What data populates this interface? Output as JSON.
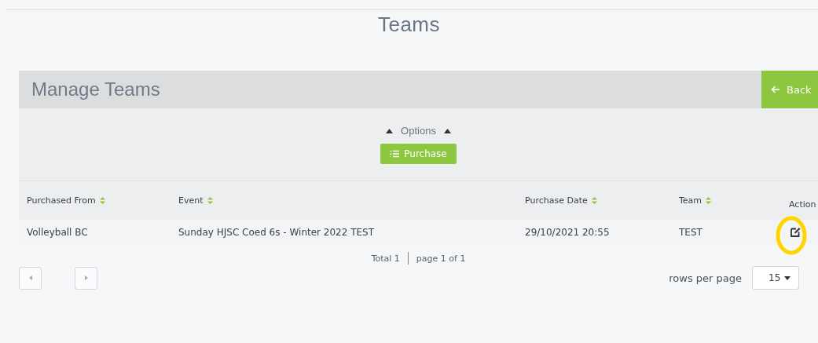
{
  "page": {
    "title": "Teams"
  },
  "panel": {
    "title": "Manage Teams",
    "back_button": "Back"
  },
  "options": {
    "label": "Options",
    "expanded": true,
    "purchase_button": "Purchase"
  },
  "table": {
    "columns": [
      {
        "label": "Purchased From",
        "sortable": true
      },
      {
        "label": "Event",
        "sortable": true
      },
      {
        "label": "Purchase Date",
        "sortable": true
      },
      {
        "label": "Team",
        "sortable": true
      },
      {
        "label": "Action",
        "sortable": false
      }
    ],
    "rows": [
      {
        "cells": [
          "Volleyball BC",
          "Sunday HJSC Coed 6s - Winter 2022 TEST",
          "29/10/2021 20:55",
          "TEST"
        ],
        "highlighted": true
      }
    ]
  },
  "pagination": {
    "total": "Total 1",
    "page": "page 1 of 1",
    "rows_label": "rows per page",
    "rows_value": "15"
  }
}
